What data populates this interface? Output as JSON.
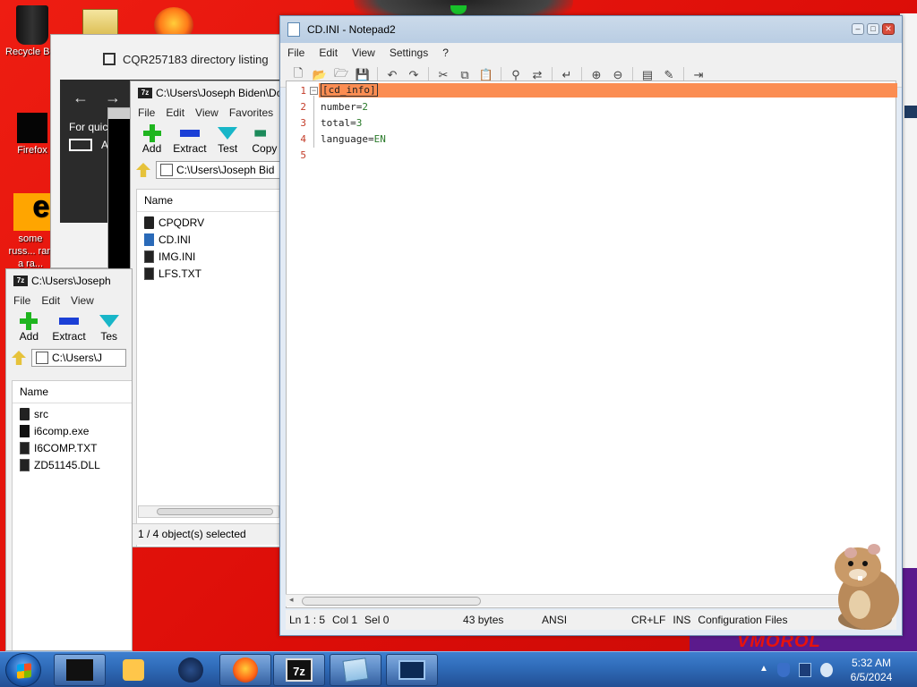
{
  "desktop": {
    "icons": [
      {
        "label": "Recycle Bin"
      },
      {
        "label": "Firefox"
      },
      {
        "label": "some russ... ran a ra..."
      }
    ],
    "overlay_text": "VMOROL"
  },
  "cqr_window": {
    "title": "CQR257183 directory listing",
    "nav_back": "←",
    "nav_forward": "→",
    "quick_text": "For quic",
    "letter": "A"
  },
  "sevenzip_back": {
    "title": "C:\\Users\\Joseph Biden\\Do",
    "menu": [
      "File",
      "Edit",
      "View",
      "Favorites"
    ],
    "toolbar": {
      "add": "Add",
      "extract": "Extract",
      "test": "Test",
      "copy": "Copy"
    },
    "address": "C:\\Users\\Joseph Bid",
    "column_name": "Name",
    "files": [
      {
        "name": "CPQDRV",
        "type": "folder"
      },
      {
        "name": "CD.INI",
        "type": "ini"
      },
      {
        "name": "IMG.INI",
        "type": "txt"
      },
      {
        "name": "LFS.TXT",
        "type": "txt"
      }
    ],
    "status": "1 / 4 object(s) selected"
  },
  "sevenzip_small": {
    "title": "C:\\Users\\Joseph",
    "menu": [
      "File",
      "Edit",
      "View"
    ],
    "toolbar": {
      "add": "Add",
      "extract": "Extract",
      "test": "Tes"
    },
    "address": "C:\\Users\\J",
    "column_name": "Name",
    "files": [
      {
        "name": "src",
        "type": "folder"
      },
      {
        "name": "i6comp.exe",
        "type": "exe"
      },
      {
        "name": "I6COMP.TXT",
        "type": "txt"
      },
      {
        "name": "ZD51145.DLL",
        "type": "txt"
      }
    ]
  },
  "notepad": {
    "title": "CD.INI - Notepad2",
    "menu": [
      "File",
      "Edit",
      "View",
      "Settings",
      "?"
    ],
    "line_numbers": [
      "1",
      "2",
      "3",
      "4",
      "5"
    ],
    "lines": {
      "l1_section": "[cd_info]",
      "l2_key": "number",
      "l2_value": "2",
      "l3_key": "total",
      "l3_value": "3",
      "l4_key": "language",
      "l4_value": "EN",
      "eq": "="
    },
    "status": {
      "position": "Ln 1 : 5",
      "col": "Col 1",
      "sel": "Sel 0",
      "size": "43 bytes",
      "encoding": "ANSI",
      "eol": "CR+LF",
      "ins": "INS",
      "scheme": "Configuration Files"
    },
    "highlight_color": "#fb8d52",
    "line_number_color": "#c43d2a"
  },
  "taskbar": {
    "time": "5:32 AM",
    "date": "6/5/2024",
    "app7z": "7z"
  }
}
